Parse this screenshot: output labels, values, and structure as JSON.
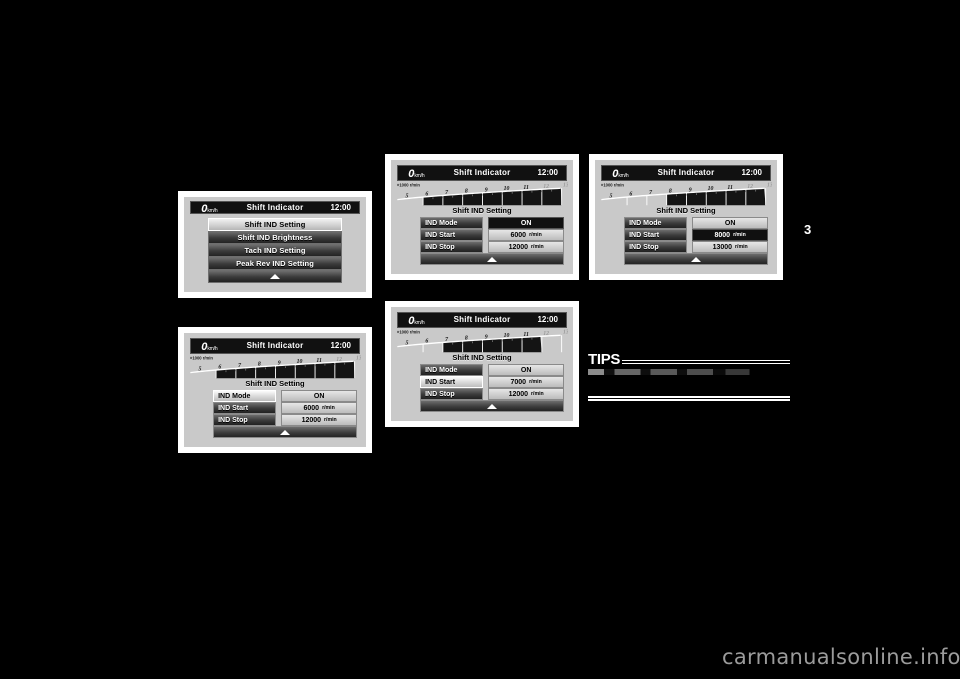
{
  "page": {
    "number": "3",
    "watermark": "carmanualsonline.info"
  },
  "lcd_common": {
    "speed_value": "0",
    "speed_unit": "km/h",
    "title": "Shift Indicator",
    "clock": "12:00",
    "tach_axis_label": "×1000 r/min",
    "tach_ticks": [
      "5",
      "6",
      "7",
      "8",
      "9",
      "10",
      "11",
      "12",
      "13"
    ],
    "tach_dim_ticks": [
      "12",
      "13"
    ],
    "settings_title": "Shift IND Setting",
    "back_icon": "up-triangle-icon",
    "unit_rmin": "r/min"
  },
  "panels": [
    {
      "id": "menu",
      "kind": "menu",
      "items": [
        {
          "label": "Shift IND Setting",
          "selected": true
        },
        {
          "label": "Shift IND Brightness",
          "selected": false
        },
        {
          "label": "Tach IND Setting",
          "selected": false
        },
        {
          "label": "Peak Rev IND Setting",
          "selected": false
        }
      ],
      "back_label": ""
    },
    {
      "id": "setting-start-6000-mode",
      "kind": "setting",
      "bar_start": 6,
      "bar_end": 13,
      "rows": [
        {
          "label": "IND Mode",
          "value": "ON",
          "unit": "",
          "label_hl": false,
          "value_dark": true
        },
        {
          "label": "IND Start",
          "value": "6000",
          "unit": "r/min",
          "label_hl": false,
          "value_dark": false
        },
        {
          "label": "IND Stop",
          "value": "12000",
          "unit": "r/min",
          "label_hl": false,
          "value_dark": false
        }
      ]
    },
    {
      "id": "setting-start-8000",
      "kind": "setting",
      "bar_start": 8,
      "bar_end": 13,
      "rows": [
        {
          "label": "IND Mode",
          "value": "ON",
          "unit": "",
          "label_hl": false,
          "value_dark": false
        },
        {
          "label": "IND Start",
          "value": "8000",
          "unit": "r/min",
          "label_hl": false,
          "value_dark": true
        },
        {
          "label": "IND Stop",
          "value": "13000",
          "unit": "r/min",
          "label_hl": false,
          "value_dark": false
        }
      ]
    },
    {
      "id": "setting-start-6000-label",
      "kind": "setting",
      "bar_start": 6,
      "bar_end": 13,
      "rows": [
        {
          "label": "IND Mode",
          "value": "ON",
          "unit": "",
          "label_hl": true,
          "value_dark": false
        },
        {
          "label": "IND Start",
          "value": "6000",
          "unit": "r/min",
          "label_hl": false,
          "value_dark": false
        },
        {
          "label": "IND Stop",
          "value": "12000",
          "unit": "r/min",
          "label_hl": false,
          "value_dark": false
        }
      ]
    },
    {
      "id": "setting-start-7000",
      "kind": "setting",
      "bar_start": 7,
      "bar_end": 12,
      "rows": [
        {
          "label": "IND Mode",
          "value": "ON",
          "unit": "",
          "label_hl": false,
          "value_dark": false
        },
        {
          "label": "IND Start",
          "value": "7000",
          "unit": "r/min",
          "label_hl": true,
          "value_dark": false
        },
        {
          "label": "IND Stop",
          "value": "12000",
          "unit": "r/min",
          "label_hl": false,
          "value_dark": false
        }
      ]
    }
  ],
  "tips": {
    "heading": "TIPS"
  }
}
